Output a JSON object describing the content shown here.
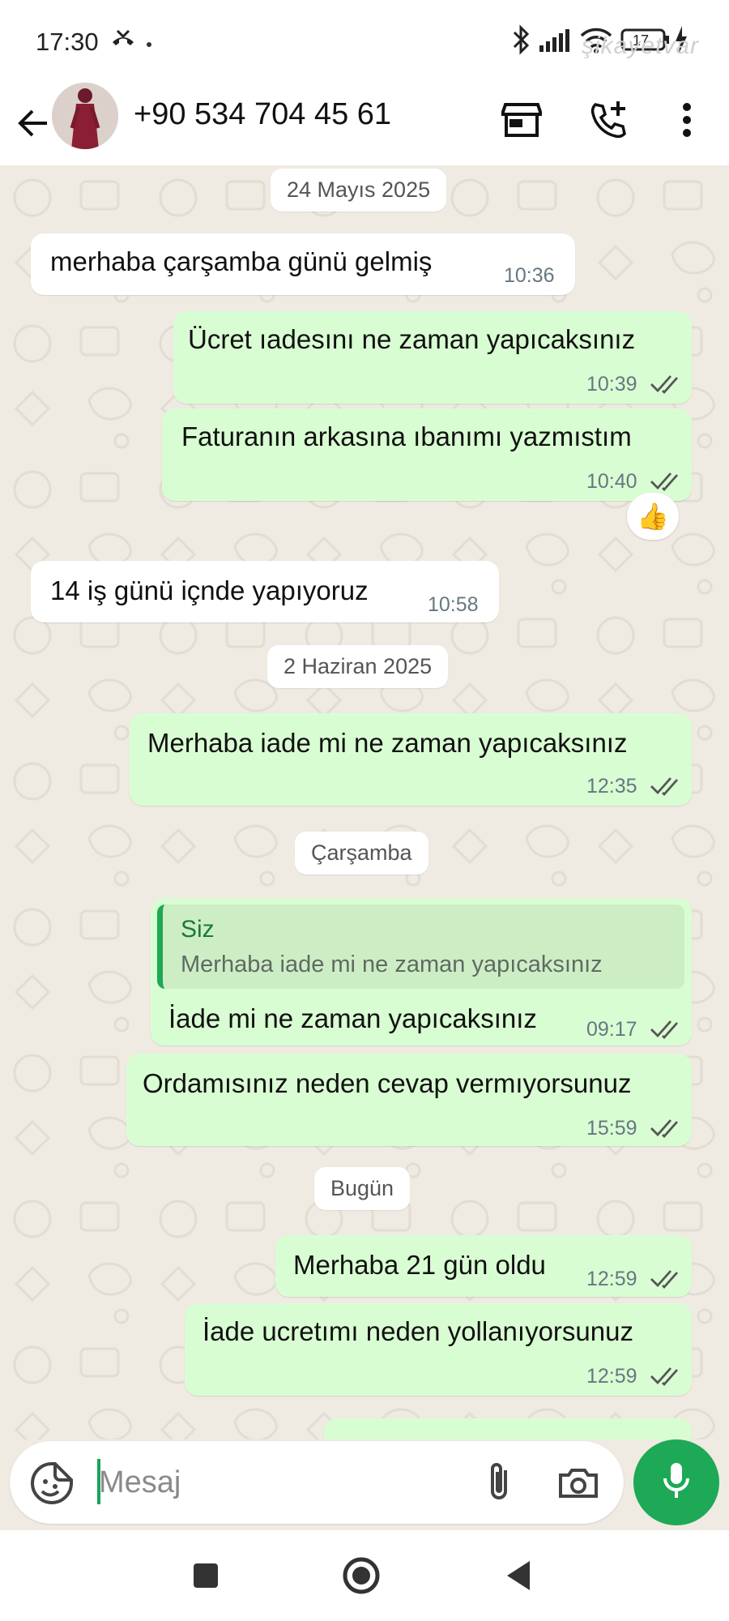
{
  "status_bar": {
    "time": "17:30",
    "battery_level": "17",
    "watermark": "şikayetvar"
  },
  "header": {
    "contact_name": "+90 534 704 45 61",
    "icons": [
      "back-arrow-icon",
      "storefront-icon",
      "add-call-icon",
      "more-vert-icon"
    ]
  },
  "chat": {
    "date_1": "24 Mayıs 2025",
    "date_2": "2 Haziran 2025",
    "date_3": "Çarşamba",
    "date_4": "Bugün",
    "messages": [
      {
        "dir": "in",
        "text": "merhaba çarşamba günü gelmiş",
        "time": "10:36"
      },
      {
        "dir": "out",
        "text": "Ücret ıadesını ne zaman yapıcaksınız",
        "time": "10:39",
        "read": true
      },
      {
        "dir": "out",
        "text": "Faturanın arkasına ıbanımı yazmıstım",
        "time": "10:40",
        "read": true,
        "reaction": "👍"
      },
      {
        "dir": "in",
        "text": "14 iş günü içnde yapıyoruz",
        "time": "10:58"
      },
      {
        "dir": "out",
        "text": "Merhaba iade mi ne zaman yapıcaksınız",
        "time": "12:35",
        "read": true
      },
      {
        "dir": "out",
        "text": "İade mi ne zaman yapıcaksınız",
        "time": "09:17",
        "read": true,
        "quote": {
          "author": "Siz",
          "text": "Merhaba iade mi ne zaman yapıcaksınız"
        }
      },
      {
        "dir": "out",
        "text": "Ordamısınız neden cevap vermıyorsunuz",
        "time": "15:59",
        "read": true
      },
      {
        "dir": "out",
        "text": "Merhaba 21 gün oldu",
        "time": "12:59",
        "read": true
      },
      {
        "dir": "out",
        "text": "İade ucretımı neden yollanıyorsunuz",
        "time": "12:59",
        "read": true
      }
    ]
  },
  "composer": {
    "placeholder": "Mesaj"
  },
  "colors": {
    "outgoing_bubble": "#d9fdd3",
    "incoming_bubble": "#ffffff",
    "accent_green": "#1da956",
    "chat_background": "#efeae2"
  }
}
